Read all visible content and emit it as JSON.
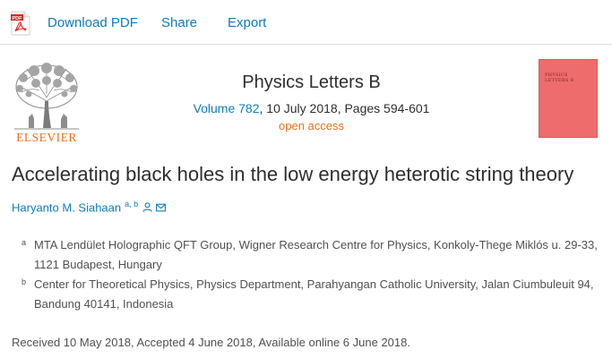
{
  "toolbar": {
    "download_pdf": "Download PDF",
    "share": "Share",
    "export": "Export",
    "pdf_icon_text": "PDF"
  },
  "journal": {
    "publisher": "ELSEVIER",
    "title": "Physics Letters B",
    "volume": "Volume 782",
    "issue_info": ", 10 July 2018, Pages 594-601",
    "access": "open access",
    "cover_title": "PHYSICS LETTERS B"
  },
  "article": {
    "title": "Accelerating black holes in the low energy heterotic string theory",
    "author": {
      "name": "Haryanto M. Siahaan",
      "superscripts": "a, b"
    },
    "affiliations": [
      {
        "label": "a",
        "text": "MTA Lendület Holographic QFT Group, Wigner Research Centre for Physics, Konkoly-Thege Miklós u. 29-33, 1121 Budapest, Hungary"
      },
      {
        "label": "b",
        "text": "Center for Theoretical Physics, Physics Department, Parahyangan Catholic University, Jalan Ciumbuleuit 94, Bandung 40141, Indonesia"
      }
    ],
    "dates": "Received 10 May 2018, Accepted 4 June 2018, Available online 6 June 2018."
  },
  "colors": {
    "link": "#0c7dbb",
    "open_access": "#e9711c",
    "elsevier": "#e9711c",
    "cover": "#ef6c6c"
  },
  "icons": [
    "pdf-icon",
    "elsevier-tree-logo",
    "person-icon",
    "email-icon"
  ]
}
